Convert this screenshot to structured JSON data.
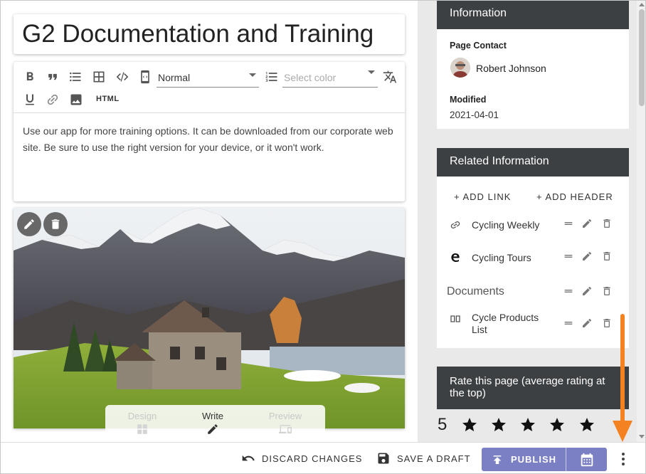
{
  "page": {
    "title": "G2 Documentation and Training"
  },
  "toolbar": {
    "format_value": "Normal",
    "color_placeholder": "Select color",
    "html_label": "HTML"
  },
  "editor": {
    "body_text": "Use our app for more training options. It can be downloaded from our corporate web site. Be sure to use the right version for your device, or it won't work."
  },
  "modes": {
    "design": "Design",
    "write": "Write",
    "preview": "Preview"
  },
  "info": {
    "heading": "Information",
    "contact_label": "Page Contact",
    "contact_name": "Robert Johnson",
    "modified_label": "Modified",
    "modified_value": "2021-04-01"
  },
  "related": {
    "heading": "Related Information",
    "add_link": "+ ADD LINK",
    "add_header": "+ ADD HEADER",
    "items": [
      {
        "label": "Cycling Weekly",
        "icon": "link-icon"
      },
      {
        "label": "Cycling Tours",
        "icon": "edge-browser-icon"
      }
    ],
    "group_header": "Documents",
    "group_items": [
      {
        "label": "Cycle Products List",
        "icon": "book-icon"
      }
    ]
  },
  "rating": {
    "heading": "Rate this page (average rating at the top)",
    "value": "5",
    "stars": 5
  },
  "actions": {
    "discard": "DISCARD CHANGES",
    "save_draft": "SAVE A DRAFT",
    "publish": "PUBLISH"
  },
  "colors": {
    "panel_header": "#3c4043",
    "publish_button": "#7b7fc4",
    "annotation_arrow": "#f58220",
    "right_panel_bg": "#e9e9e9"
  }
}
